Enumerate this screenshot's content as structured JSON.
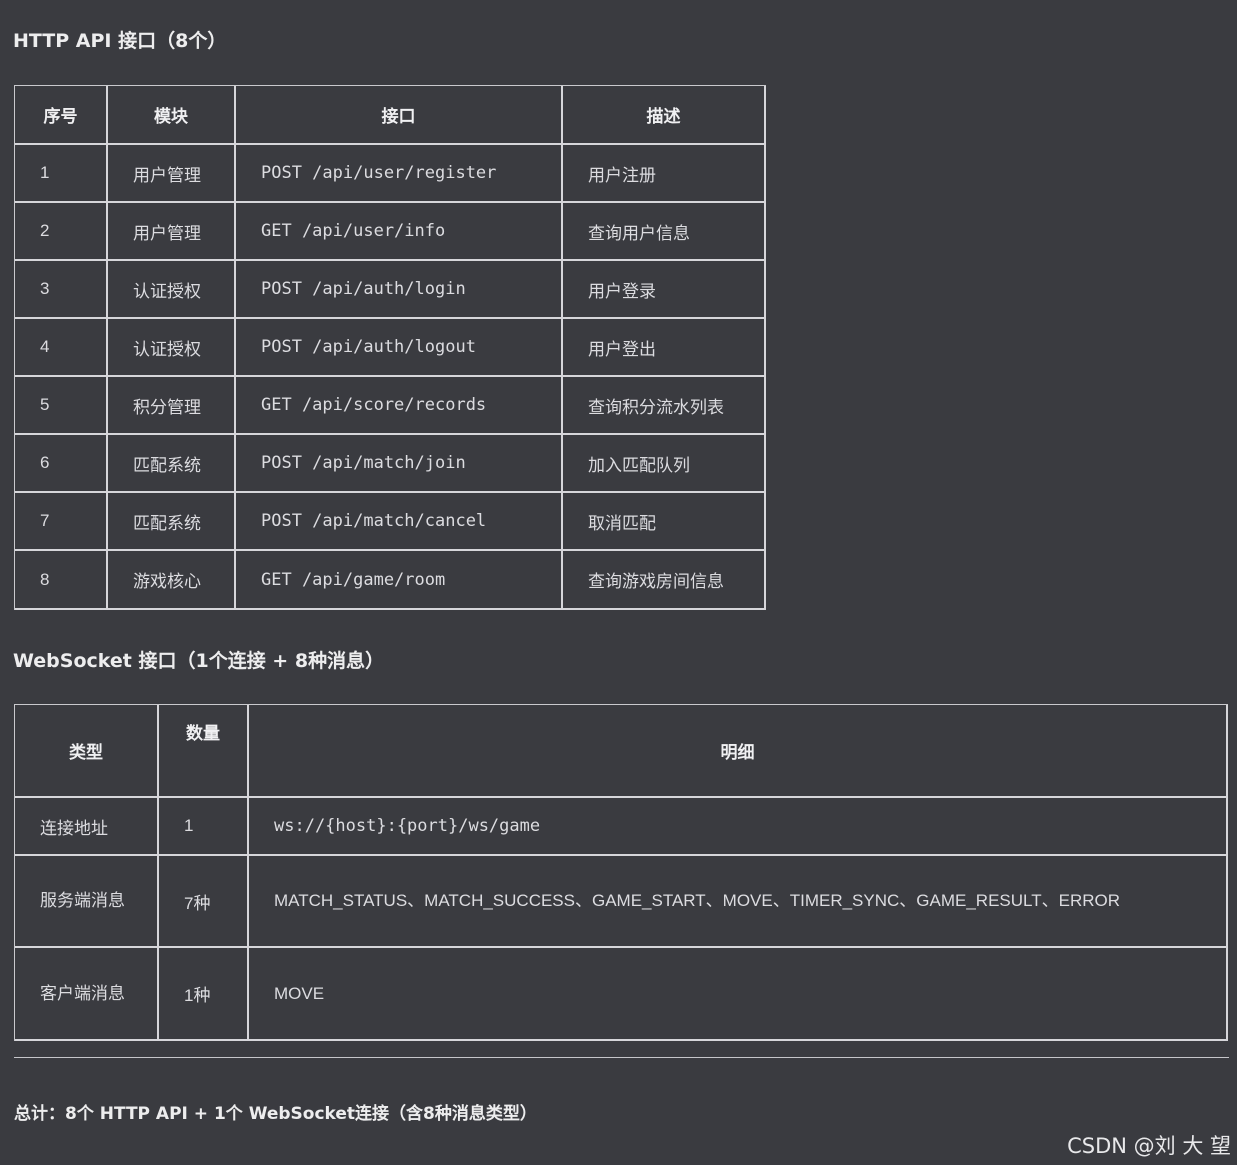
{
  "http_section": {
    "heading": "HTTP API 接口（8个）",
    "headers": [
      "序号",
      "模块",
      "接口",
      "描述"
    ],
    "rows": [
      {
        "no": "1",
        "module": "用户管理",
        "endpoint": "POST /api/user/register",
        "desc": "用户注册"
      },
      {
        "no": "2",
        "module": "用户管理",
        "endpoint": "GET /api/user/info",
        "desc": "查询用户信息"
      },
      {
        "no": "3",
        "module": "认证授权",
        "endpoint": "POST /api/auth/login",
        "desc": "用户登录"
      },
      {
        "no": "4",
        "module": "认证授权",
        "endpoint": "POST /api/auth/logout",
        "desc": "用户登出"
      },
      {
        "no": "5",
        "module": "积分管理",
        "endpoint": "GET /api/score/records",
        "desc": "查询积分流水列表"
      },
      {
        "no": "6",
        "module": "匹配系统",
        "endpoint": "POST /api/match/join",
        "desc": "加入匹配队列"
      },
      {
        "no": "7",
        "module": "匹配系统",
        "endpoint": "POST /api/match/cancel",
        "desc": "取消匹配"
      },
      {
        "no": "8",
        "module": "游戏核心",
        "endpoint": "GET /api/game/room",
        "desc": "查询游戏房间信息"
      }
    ]
  },
  "ws_section": {
    "heading": "WebSocket 接口（1个连接 + 8种消息）",
    "headers": [
      "类型",
      "数量",
      "明细"
    ],
    "rows": [
      {
        "type": "连接地址",
        "count": "1",
        "detail": "ws://{host}:{port}/ws/game"
      },
      {
        "type": "服务端消息",
        "count": "7种",
        "detail": "MATCH_STATUS、MATCH_SUCCESS、GAME_START、MOVE、TIMER_SYNC、GAME_RESULT、ERROR"
      },
      {
        "type": "客户端消息",
        "count": "1种",
        "detail": "MOVE"
      }
    ]
  },
  "summary": "总计：8个 HTTP API + 1个 WebSocket连接（含8种消息类型）",
  "watermark": "CSDN @刘 大 望",
  "colors": {
    "background": "#3a3b40",
    "code": "#e0a36f",
    "border": "#d6d6da"
  }
}
